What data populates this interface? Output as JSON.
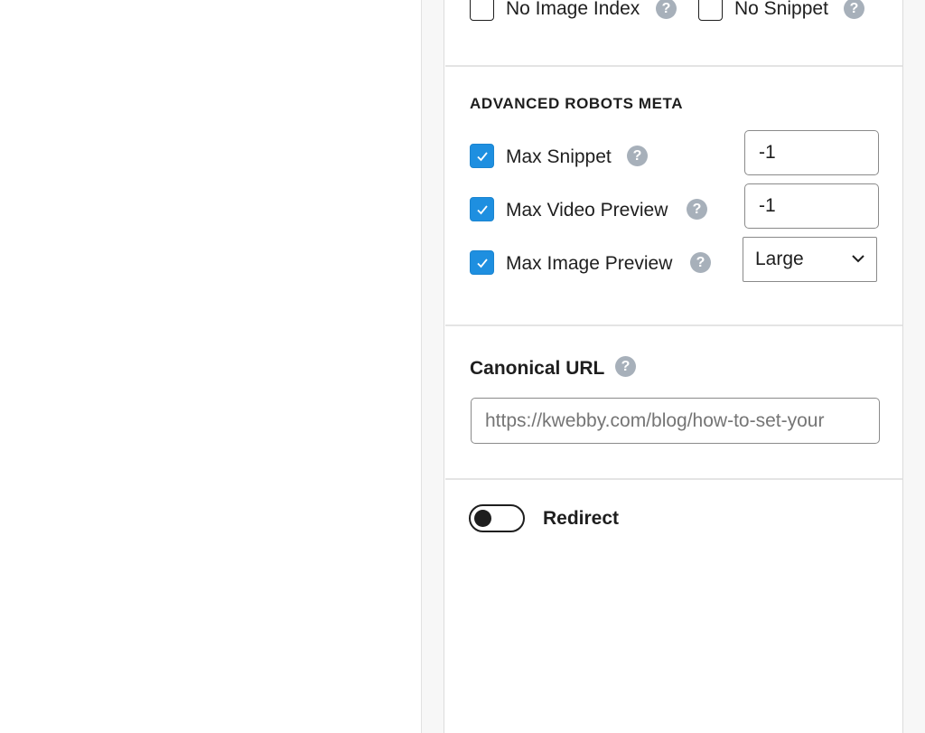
{
  "robots_meta": {
    "no_image_index": {
      "label": "No Image Index",
      "checked": false
    },
    "no_snippet": {
      "label": "No Snippet",
      "checked": false
    }
  },
  "advanced_robots_meta": {
    "title": "ADVANCED ROBOTS META",
    "max_snippet": {
      "label": "Max Snippet",
      "checked": true,
      "value": "-1"
    },
    "max_video_preview": {
      "label": "Max Video Preview",
      "checked": true,
      "value": "-1"
    },
    "max_image_preview": {
      "label": "Max Image Preview",
      "checked": true,
      "selected": "Large"
    }
  },
  "canonical": {
    "label": "Canonical URL",
    "placeholder": "https://kwebby.com/blog/how-to-set-your"
  },
  "redirect": {
    "label": "Redirect",
    "enabled": false
  },
  "icons": {
    "help": "?"
  },
  "colors": {
    "accent": "#1e8fe0",
    "help_icon": "#a7b0ba"
  }
}
